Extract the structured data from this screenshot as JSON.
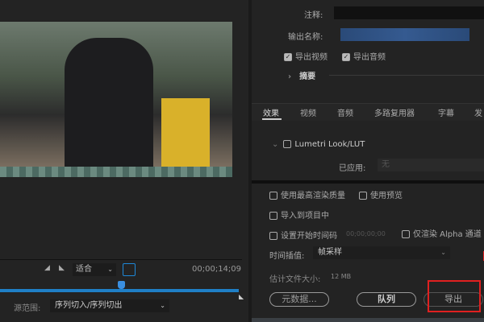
{
  "preview": {
    "zoom": "适合",
    "timecode": "00;00;14;09",
    "source_range_label": "源范围:",
    "source_range_value": "序列切入/序列切出"
  },
  "output": {
    "comment_label": "注释:",
    "comment_value": "",
    "output_name_label": "输出名称:",
    "export_video": "导出视频",
    "export_audio": "导出音频",
    "summary": "摘要"
  },
  "tabs": [
    "效果",
    "视频",
    "音频",
    "多路复用器",
    "字幕",
    "发"
  ],
  "effects": {
    "lumetri": "Lumetri Look/LUT",
    "applied_label": "已应用:",
    "applied_value": "无"
  },
  "options": {
    "max_quality": "使用最高渲染质量",
    "use_preview": "使用预览",
    "import_project": "导入到项目中",
    "set_timecode": "设置开始时间码",
    "timecode_value": "00;00;00;00",
    "alpha_only": "仅渲染 Alpha 通道",
    "interp_label": "时间插值:",
    "interp_value": "帧采样",
    "filesize_label": "估计文件大小:",
    "filesize_value": "12 MB"
  },
  "buttons": {
    "metadata": "元数据...",
    "queue": "队列",
    "export": "导出"
  },
  "colors": {
    "accent": "#1e88d8",
    "highlight": "#e02020"
  }
}
